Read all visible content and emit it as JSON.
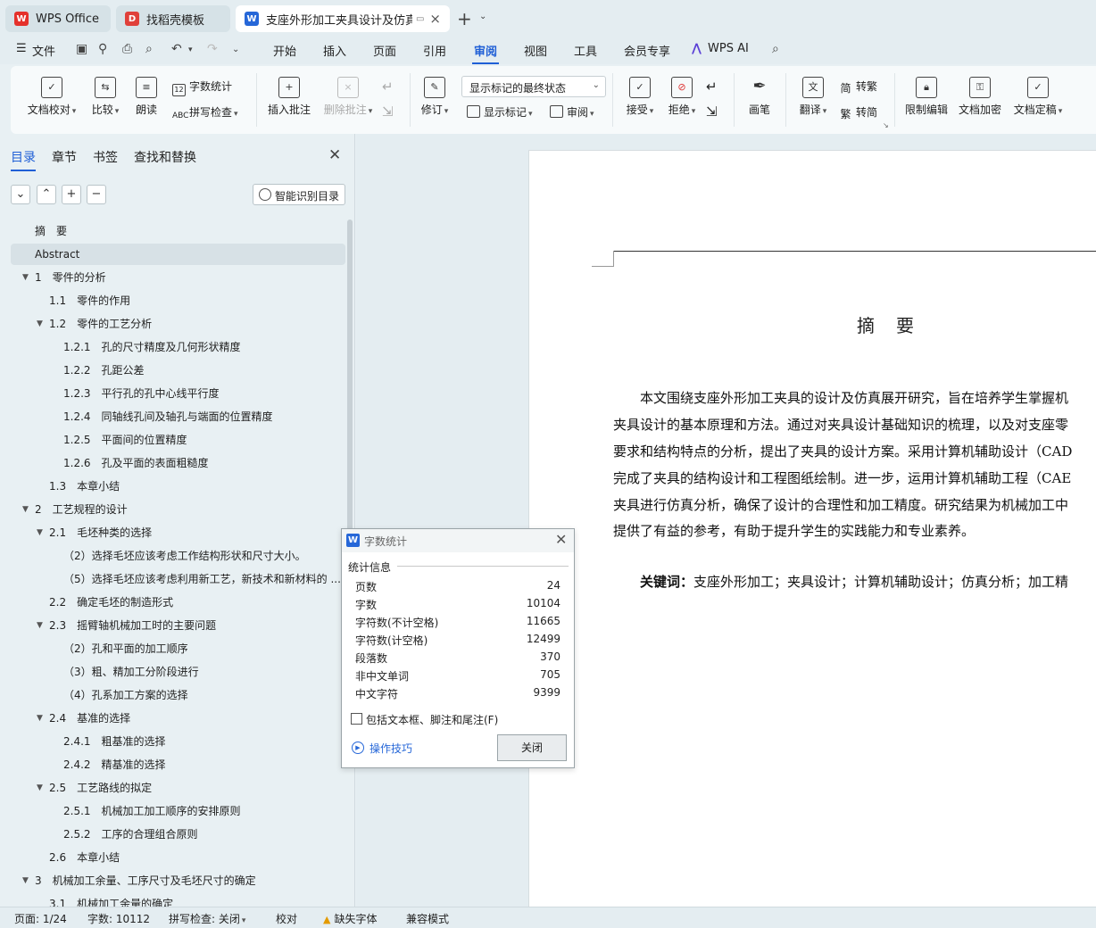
{
  "tabs": [
    {
      "label": "WPS Office",
      "logo": "W"
    },
    {
      "label": "找稻壳模板",
      "logo": "D"
    },
    {
      "label": "支座外形加工夹具设计及仿真",
      "logo": "W"
    }
  ],
  "menu": {
    "file": "文件",
    "items": [
      "开始",
      "插入",
      "页面",
      "引用",
      "审阅",
      "视图",
      "工具",
      "会员专享"
    ],
    "active": "审阅",
    "ai": "WPS AI"
  },
  "ribbon": {
    "doc_check": "文档校对",
    "compare": "比较",
    "read_aloud": "朗读",
    "word_count": "字数统计",
    "spell_check": "拼写检查",
    "insert_comment": "插入批注",
    "delete_comment": "删除批注",
    "track": "修订",
    "display_state": "显示标记的最终状态",
    "show_markup": "显示标记",
    "review": "审阅",
    "accept": "接受",
    "reject": "拒绝",
    "pen": "画笔",
    "translate": "翻译",
    "to_traditional": "转繁",
    "to_simplified": "转简",
    "restrict_edit": "限制编辑",
    "encrypt": "文档加密",
    "finalize": "文档定稿"
  },
  "panel": {
    "tabs": [
      "目录",
      "章节",
      "书签",
      "查找和替换"
    ],
    "smart_toc": "智能识别目录",
    "toc": [
      {
        "label": "摘　要",
        "level": 0,
        "toggle": false
      },
      {
        "label": "Abstract",
        "level": 0,
        "toggle": false,
        "selected": true
      },
      {
        "label": "1　零件的分析",
        "level": 0,
        "toggle": true
      },
      {
        "label": "1.1　零件的作用",
        "level": 1,
        "toggle": false
      },
      {
        "label": "1.2　零件的工艺分析",
        "level": 1,
        "toggle": true
      },
      {
        "label": "1.2.1　孔的尺寸精度及几何形状精度",
        "level": 2,
        "toggle": false
      },
      {
        "label": "1.2.2　孔距公差",
        "level": 2,
        "toggle": false
      },
      {
        "label": "1.2.3　平行孔的孔中心线平行度",
        "level": 2,
        "toggle": false
      },
      {
        "label": "1.2.4　同轴线孔间及轴孔与端面的位置精度",
        "level": 2,
        "toggle": false
      },
      {
        "label": "1.2.5　平面间的位置精度",
        "level": 2,
        "toggle": false
      },
      {
        "label": "1.2.6　孔及平面的表面粗糙度",
        "level": 2,
        "toggle": false
      },
      {
        "label": "1.3　本章小结",
        "level": 1,
        "toggle": false
      },
      {
        "label": "2　工艺规程的设计",
        "level": 0,
        "toggle": true
      },
      {
        "label": "2.1　毛坯种类的选择",
        "level": 1,
        "toggle": true
      },
      {
        "label": "（2）选择毛坯应该考虑工作结构形状和尺寸大小。",
        "level": 2,
        "toggle": false
      },
      {
        "label": "（5）选择毛坯应该考虑利用新工艺，新技术和新材料的 ...",
        "level": 2,
        "toggle": false
      },
      {
        "label": "2.2　确定毛坯的制造形式",
        "level": 1,
        "toggle": false
      },
      {
        "label": "2.3　摇臂轴机械加工时的主要问题",
        "level": 1,
        "toggle": true
      },
      {
        "label": "（2）孔和平面的加工顺序",
        "level": 2,
        "toggle": false
      },
      {
        "label": "（3）粗、精加工分阶段进行",
        "level": 2,
        "toggle": false
      },
      {
        "label": "（4）孔系加工方案的选择",
        "level": 2,
        "toggle": false
      },
      {
        "label": "2.4　基准的选择",
        "level": 1,
        "toggle": true
      },
      {
        "label": "2.4.1　粗基准的选择",
        "level": 2,
        "toggle": false
      },
      {
        "label": "2.4.2　精基准的选择",
        "level": 2,
        "toggle": false
      },
      {
        "label": "2.5　工艺路线的拟定",
        "level": 1,
        "toggle": true
      },
      {
        "label": "2.5.1　机械加工加工顺序的安排原则",
        "level": 2,
        "toggle": false
      },
      {
        "label": "2.5.2　工序的合理组合原则",
        "level": 2,
        "toggle": false
      },
      {
        "label": "2.6　本章小结",
        "level": 1,
        "toggle": false
      },
      {
        "label": "3　机械加工余量、工序尺寸及毛坯尺寸的确定",
        "level": 0,
        "toggle": true
      },
      {
        "label": "3.1　机械加工余量的确定",
        "level": 1,
        "toggle": false
      }
    ]
  },
  "document": {
    "title": "摘　要",
    "lines": [
      "　　本文围绕支座外形加工夹具的设计及仿真展开研究，旨在培养学生掌握机",
      "夹具设计的基本原理和方法。通过对夹具设计基础知识的梳理，以及对支座零",
      "要求和结构特点的分析，提出了夹具的设计方案。采用计算机辅助设计（CAD",
      "完成了夹具的结构设计和工程图纸绘制。进一步，运用计算机辅助工程（CAE",
      "夹具进行仿真分析，确保了设计的合理性和加工精度。研究结果为机械加工中",
      "提供了有益的参考，有助于提升学生的实践能力和专业素养。"
    ],
    "keywords_label": "　　关键词：",
    "keywords": "支座外形加工；夹具设计；计算机辅助设计；仿真分析；加工精"
  },
  "dialog": {
    "title": "字数统计",
    "group": "统计信息",
    "stats": [
      {
        "label": "页数",
        "value": "24"
      },
      {
        "label": "字数",
        "value": "10104"
      },
      {
        "label": "字符数(不计空格)",
        "value": "11665"
      },
      {
        "label": "字符数(计空格)",
        "value": "12499"
      },
      {
        "label": "段落数",
        "value": "370"
      },
      {
        "label": "非中文单词",
        "value": "705"
      },
      {
        "label": "中文字符",
        "value": "9399"
      }
    ],
    "include_label": "包括文本框、脚注和尾注(F)",
    "include_checked": false,
    "tips": "操作技巧",
    "close": "关闭"
  },
  "status": {
    "page": "页面: 1/24",
    "words": "字数: 10112",
    "spell": "拼写检查: 关闭",
    "proof": "校对",
    "missing_font": "缺失字体",
    "compat": "兼容模式"
  },
  "colors": {
    "accent": "#1f5fd6",
    "wps_red": "#e5312b",
    "docer_red": "#e0403a",
    "writer_blue": "#2667d8"
  }
}
